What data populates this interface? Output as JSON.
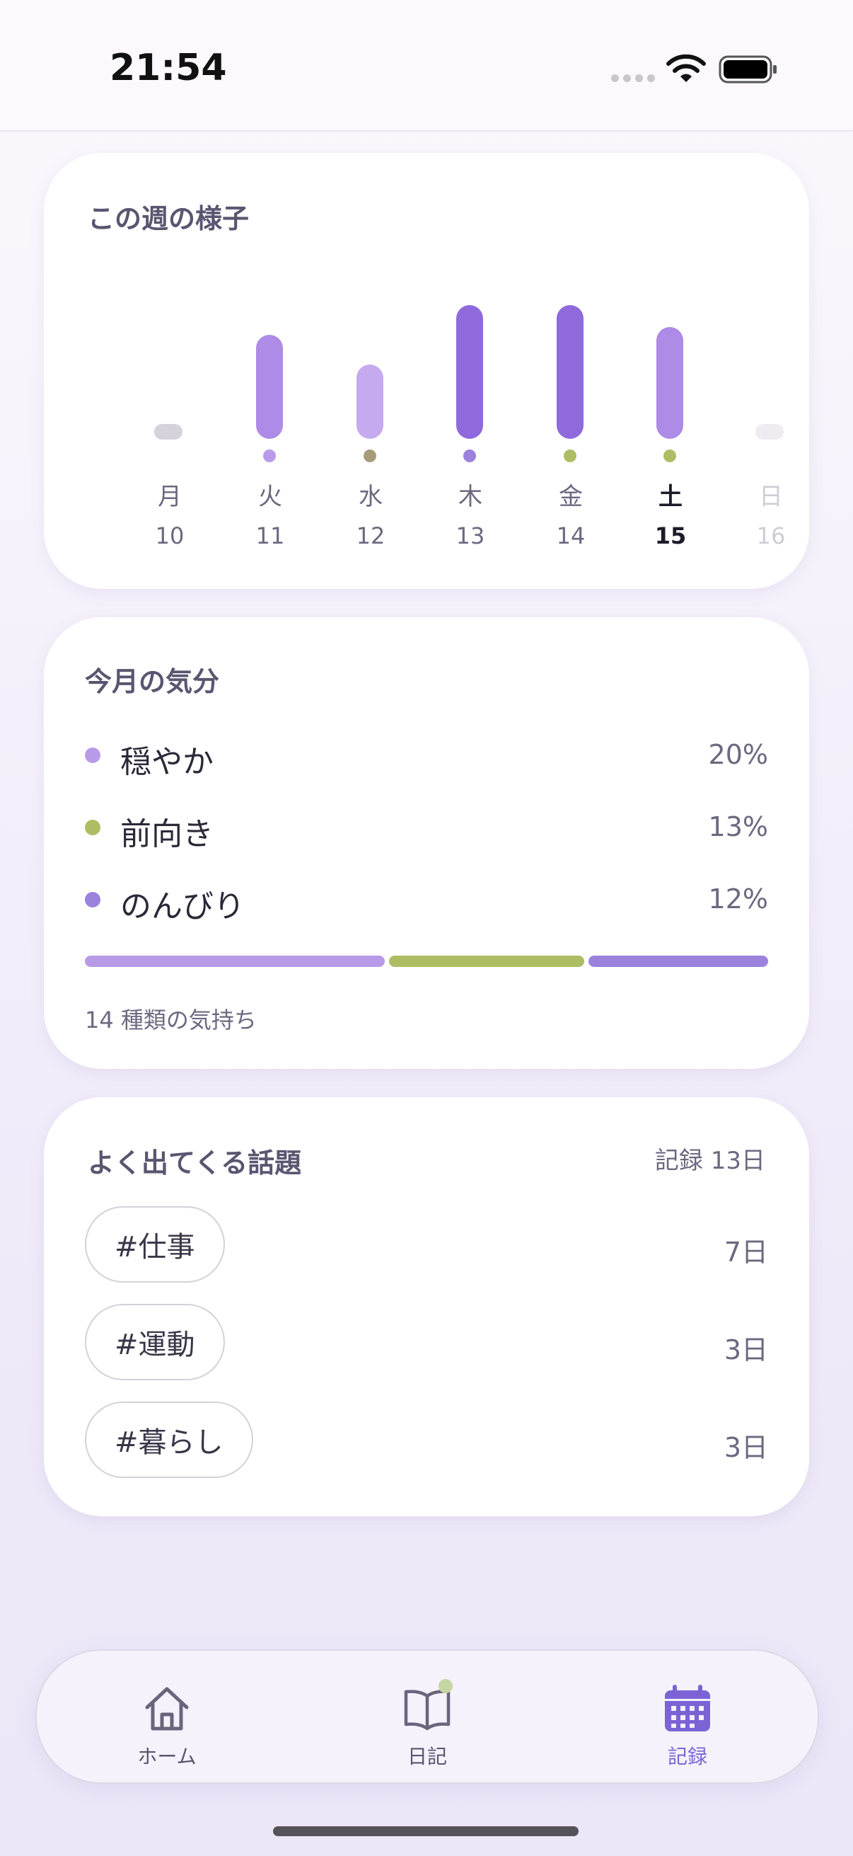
{
  "status_bar": {
    "time": "21:54"
  },
  "colors": {
    "accent": "#7b63d6",
    "mood_calm": "#b99ae8",
    "mood_positive": "#adbd63",
    "mood_relaxed": "#9b82dc",
    "mood_muted": "#a79c78"
  },
  "week_card": {
    "title": "この週の様子",
    "days": [
      {
        "day": "月",
        "date": "10",
        "level": 0,
        "bar_color": "#d6d2db",
        "dot_color": null,
        "state": "past"
      },
      {
        "day": "火",
        "date": "11",
        "level": 0.7,
        "bar_color": "#ad8be6",
        "dot_color": "#b99ae8",
        "state": "past"
      },
      {
        "day": "水",
        "date": "12",
        "level": 0.5,
        "bar_color": "#c5aaf0",
        "dot_color": "#a79c78",
        "state": "past"
      },
      {
        "day": "木",
        "date": "13",
        "level": 0.9,
        "bar_color": "#8e6adc",
        "dot_color": "#9b82dc",
        "state": "past"
      },
      {
        "day": "金",
        "date": "14",
        "level": 0.9,
        "bar_color": "#8e6adc",
        "dot_color": "#adbd63",
        "state": "past"
      },
      {
        "day": "土",
        "date": "15",
        "level": 0.75,
        "bar_color": "#ad8be6",
        "dot_color": "#adbd63",
        "state": "today"
      },
      {
        "day": "日",
        "date": "16",
        "level": 0,
        "bar_color": "#eeecf1",
        "dot_color": null,
        "state": "future"
      }
    ]
  },
  "mood_card": {
    "title": "今月の気分",
    "moods": [
      {
        "name": "穏やか",
        "percent": "20%",
        "color": "#b99ae8"
      },
      {
        "name": "前向き",
        "percent": "13%",
        "color": "#adbd63"
      },
      {
        "name": "のんびり",
        "percent": "12%",
        "color": "#9b82dc"
      }
    ],
    "note": "14 種類の気持ち"
  },
  "topics_card": {
    "title": "よく出てくる話題",
    "record_count": "記録 13日",
    "topics": [
      {
        "tag": "#仕事",
        "days": "7日"
      },
      {
        "tag": "#運動",
        "days": "3日"
      },
      {
        "tag": "#暮らし",
        "days": "3日"
      }
    ]
  },
  "tab_bar": {
    "items": [
      {
        "label": "ホーム",
        "icon": "house-icon"
      },
      {
        "label": "日記",
        "icon": "book-icon"
      },
      {
        "label": "記録",
        "icon": "calendar-icon"
      }
    ],
    "active": "記録"
  }
}
